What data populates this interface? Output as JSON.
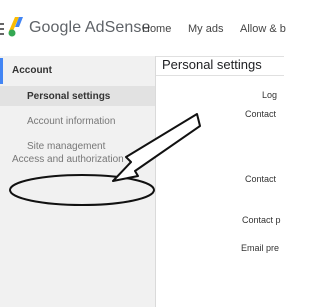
{
  "header": {
    "brand": "Google AdSense",
    "nav": [
      "Home",
      "My ads",
      "Allow & b"
    ]
  },
  "sidebar": {
    "section_title": "Account",
    "items": [
      {
        "label": "Personal settings",
        "active": true
      },
      {
        "label": "Account information",
        "active": false
      },
      {
        "label": "Site management",
        "active": false
      }
    ],
    "access": "Access and authorization"
  },
  "main": {
    "title": "Personal settings",
    "fields": [
      "Log",
      "Contact",
      "Contact",
      "Contact p",
      "Email pre"
    ]
  },
  "colors": {
    "accent": "#4285f4",
    "logo_yellow": "#fbbc04",
    "logo_blue": "#4285f4",
    "logo_green": "#34a853"
  }
}
